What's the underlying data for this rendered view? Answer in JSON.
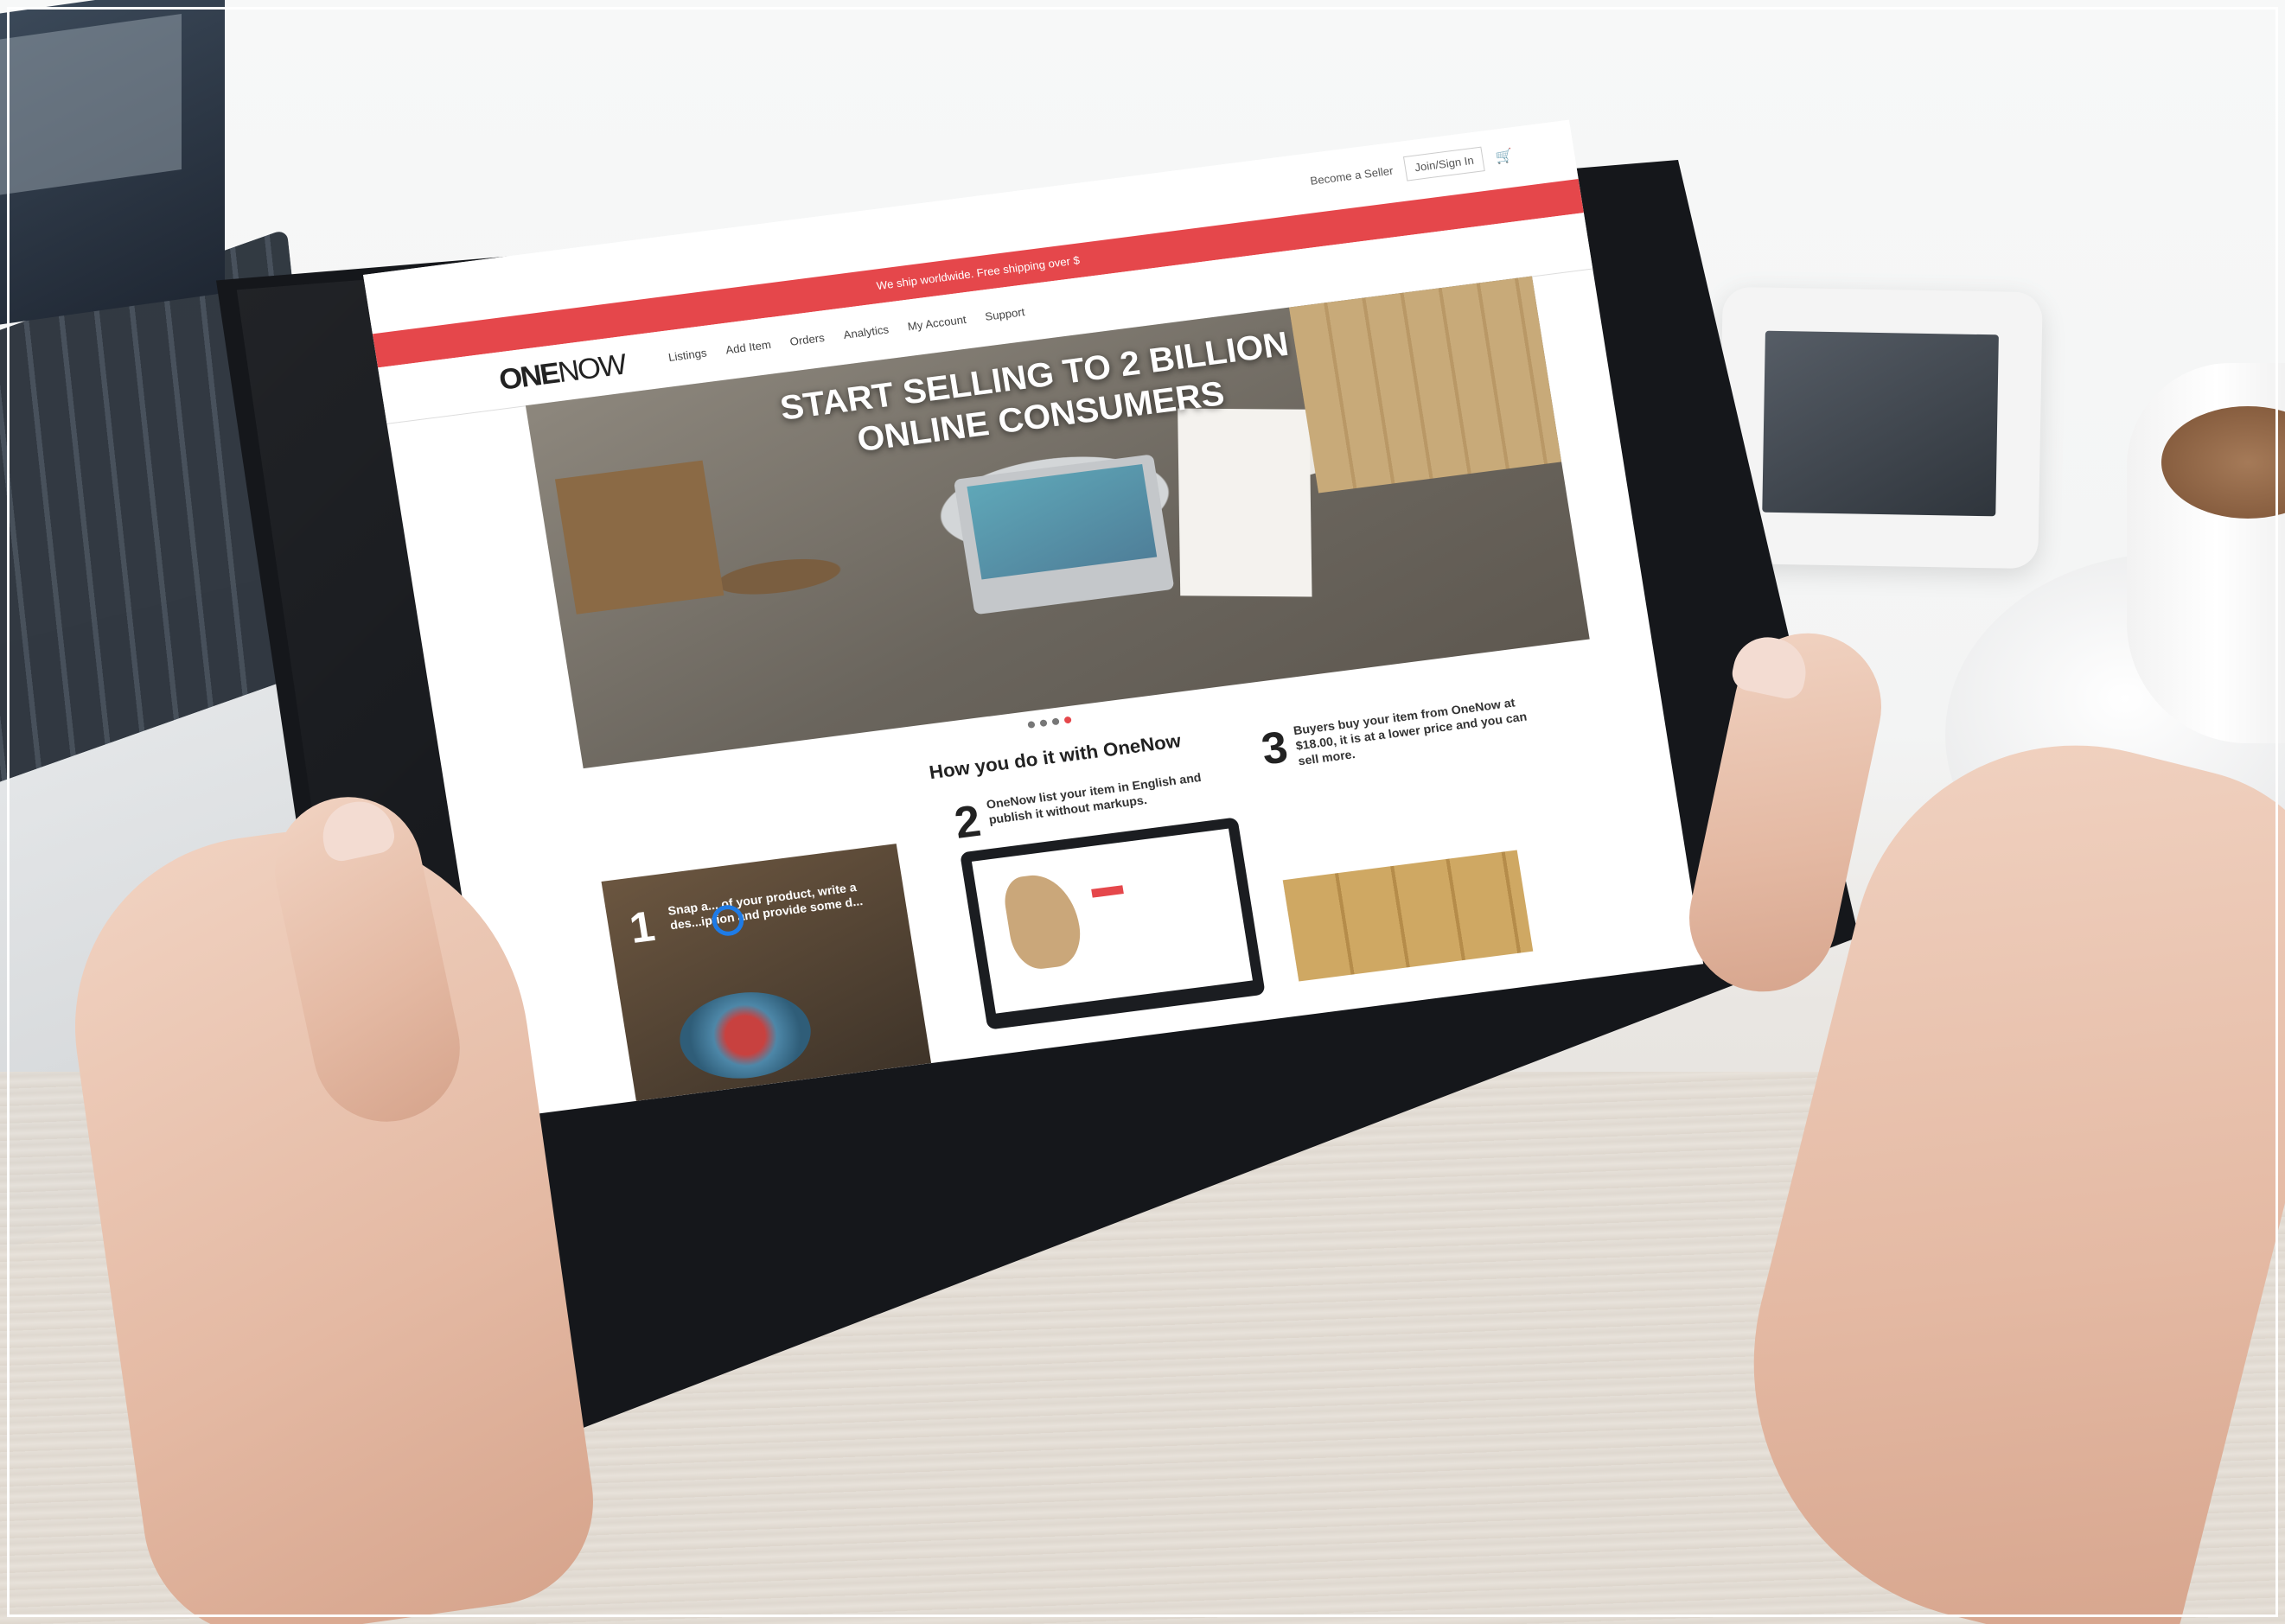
{
  "screen": {
    "promo": "We ship worldwide. Free shipping over $",
    "top_links": {
      "seller": "Become a Seller",
      "login": "Join/Sign In"
    },
    "logo": {
      "one": "ONE",
      "now": "NOW"
    },
    "menu": [
      "Listings",
      "Add Item",
      "Orders",
      "Analytics",
      "My Account",
      "Support"
    ],
    "hero_title_line1": "START SELLING TO 2 BILLION",
    "hero_title_line2": "ONLINE CONSUMERS",
    "carousel_dots": 4,
    "how_title": "How you do it with OneNow",
    "steps": [
      {
        "num": "1",
        "text": "Snap a... of your product, write a des...iption and provide some d..."
      },
      {
        "num": "2",
        "text": "OneNow list your item in English and publish it without markups."
      },
      {
        "num": "3",
        "text": "Buyers buy your item from OneNow at $18.00, it is at a lower price and you can sell more."
      }
    ]
  },
  "icons": [
    "cart-icon"
  ]
}
